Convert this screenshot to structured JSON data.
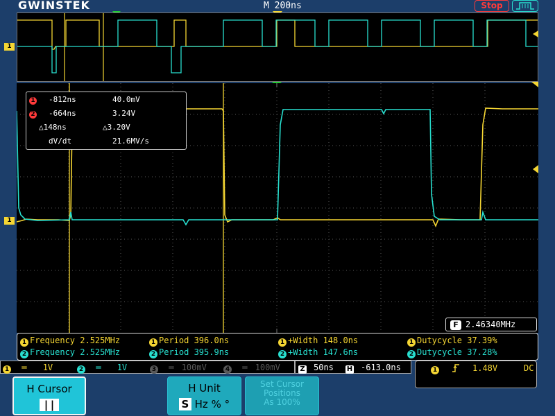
{
  "header": {
    "brand": "GWINSTEK",
    "timebase": "M 200ns",
    "run_state": "Stop"
  },
  "markers": {
    "ch1": "1",
    "cursor1": "1",
    "cursor2": "2"
  },
  "cursors": {
    "c1_time": "-812ns",
    "c1_volt": "40.0mV",
    "c2_time": "-664ns",
    "c2_volt": "3.24V",
    "delta_time": "△148ns",
    "delta_volt": "△3.20V",
    "slope_label": "dV/dt",
    "slope_value": "21.6MV/s"
  },
  "frequency_counter": {
    "badge": "F",
    "value": "2.46340MHz"
  },
  "measurements": {
    "ch1": {
      "frequency": "Frequency 2.525MHz",
      "period": "Period 396.0ns",
      "width": "+Width 148.0ns",
      "duty": "Dutycycle 37.39%"
    },
    "ch2": {
      "frequency": "Frequency 2.525MHz",
      "period": "Period 395.9ns",
      "width": "+Width 147.6ns",
      "duty": "Dutycycle 37.28%"
    }
  },
  "channels": [
    {
      "num": "1",
      "scale": "1V",
      "active": true
    },
    {
      "num": "2",
      "scale": "1V",
      "active": true
    },
    {
      "num": "3",
      "scale": "100mV",
      "active": false
    },
    {
      "num": "4",
      "scale": "100mV",
      "active": false
    }
  ],
  "horizontal": {
    "zoom_badge": "Z",
    "zoom_scale": "50ns",
    "pos_badge": "H",
    "position": "-613.0ns"
  },
  "trigger": {
    "source": "1",
    "level": "1.48V",
    "coupling": "DC"
  },
  "softkeys": {
    "h_cursor_label": "H Cursor",
    "h_cursor_value": "||",
    "h_unit_label": "H Unit",
    "h_unit_badge": "S",
    "h_unit_options": "Hz % °",
    "set_cursor_line1": "Set Cursor",
    "set_cursor_line2": "Positions",
    "set_cursor_line3": "As 100%"
  },
  "colors": {
    "ch1": "#f5d633",
    "ch2": "#28e0d0",
    "background": "#1c3e6a",
    "cursor_marker": "#ff3a3a",
    "trigger_marker": "#22cc33"
  }
}
